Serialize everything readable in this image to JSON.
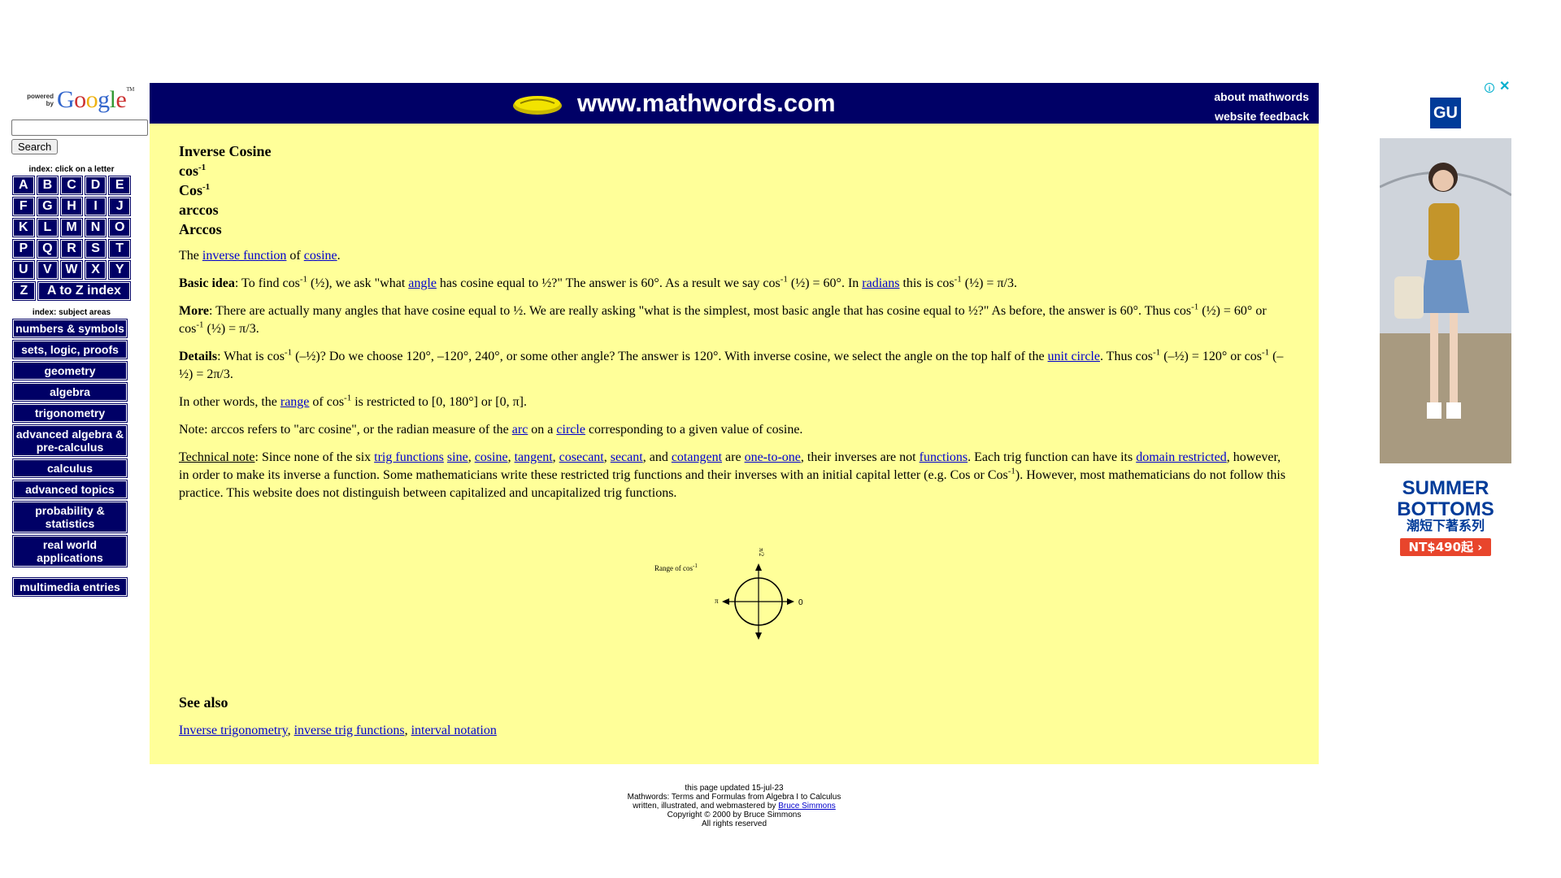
{
  "sidebar": {
    "powered_by": "powered by",
    "google_logo": "Google",
    "google_tm": "TM",
    "search_button": "Search",
    "letter_index_caption": "index: click on a letter",
    "letters": [
      [
        "A",
        "B",
        "C",
        "D",
        "E"
      ],
      [
        "F",
        "G",
        "H",
        "I",
        "J"
      ],
      [
        "K",
        "L",
        "M",
        "N",
        "O"
      ],
      [
        "P",
        "Q",
        "R",
        "S",
        "T"
      ],
      [
        "U",
        "V",
        "W",
        "X",
        "Y"
      ]
    ],
    "letter_z": "Z",
    "a_to_z": "A to Z index",
    "subject_caption": "index: subject areas",
    "subjects": [
      "numbers & symbols",
      "sets, logic, proofs",
      "geometry",
      "algebra",
      "trigonometry",
      "advanced algebra & pre-calculus",
      "calculus",
      "advanced topics",
      "probability & statistics",
      "real world applications"
    ],
    "multimedia": "multimedia entries"
  },
  "header": {
    "site_title": "www.mathwords.com",
    "about": "about mathwords",
    "feedback": "website feedback",
    "colors": {
      "banner": "#000066",
      "content": "#ffff99",
      "link": "#0000cc"
    }
  },
  "entry": {
    "titles": [
      "Inverse Cosine",
      "cos",
      "Cos",
      "arccos",
      "Arccos"
    ],
    "sup": "-1",
    "intro": {
      "the": "The",
      "inverse_function": "inverse function",
      "of": "of",
      "cosine": "cosine",
      "end": "."
    },
    "basic": {
      "label": "Basic idea",
      "t1": ": To find cos",
      "t2": " (½), we ask \"what ",
      "angle": "angle",
      "t3": " has cosine equal to ½?\" The answer is 60°. As a result we say cos",
      "t4": " (½) = 60°. In ",
      "radians": "radians",
      "t5": " this is cos",
      "t6": " (½) = π/3."
    },
    "more": {
      "label": "More",
      "t1": ": There are actually many angles that have cosine equal to ½. We are really asking \"what is the simplest, most basic angle that has cosine equal to ½?\" As before, the answer is 60°. Thus cos",
      "t2": " (½) = 60° or cos",
      "t3": " (½) = π/3."
    },
    "details": {
      "label": "Details",
      "t1": ": What is cos",
      "t2": " (–½)? Do we choose 120°, –120°, 240°, or some other angle? The answer is 120°. With inverse cosine, we select the angle on the top half of the ",
      "unit_circle": "unit circle",
      "t3": ". Thus cos",
      "t4": " (–½) = 120° or cos",
      "t5": " (–½) = 2π/3."
    },
    "other_words": {
      "t1": "In other words, the ",
      "range": "range",
      "t2": " of cos",
      "t3": " is restricted to [0, 180°] or [0, π]."
    },
    "note": {
      "t1": "Note: arccos refers to \"arc cosine\", or the radian measure of the ",
      "arc": "arc",
      "t2": " on a ",
      "circle": "circle",
      "t3": " corresponding to a given value of cosine."
    },
    "technical": {
      "label": "Technical note",
      "t1": ": Since none of the six ",
      "trig_functions": "trig functions",
      "sine": "sine",
      "cosine": "cosine",
      "tangent": "tangent",
      "cosecant": "cosecant",
      "secant": "secant",
      "cotangent": "cotangent",
      "one_to_one": "one-to-one",
      "functions": "functions",
      "domain_restricted": "domain restricted",
      "c": ", ",
      "sp": " ",
      "and": ", and ",
      "are": " are ",
      "t2": ", their inverses are not ",
      "t3": ". Each trig function can have its ",
      "t4": ", however, in order to make its inverse a function. Some mathematicians write these restricted trig functions and their inverses with an initial capital letter (e.g. Cos or Cos",
      "t5": "). However, most mathematicians do not follow this practice. This website does not distinguish between capitalized and uncapitalized trig functions."
    },
    "diagram": {
      "range_label": "Range of cos",
      "sup": "-1",
      "top_label": "π/2",
      "left_label": "π",
      "right_label": "0"
    },
    "see_also": {
      "heading": "See also",
      "links": [
        "Inverse trigonometry",
        "inverse trig functions",
        "interval notation"
      ],
      "sep": ", "
    }
  },
  "footer": {
    "updated": "this page updated 15-jul-23",
    "tagline": "Mathwords: Terms and Formulas from Algebra I to Calculus",
    "written": "written, illustrated, and webmastered by ",
    "author": "Bruce Simmons",
    "copyright": "Copyright © 2000 by Bruce Simmons",
    "rights": "All rights reserved"
  },
  "ad": {
    "info_icon": "i",
    "close_icon": "✕",
    "brand": "GU",
    "headline": "SUMMER BOTTOMS",
    "sub": "潮短下著系列",
    "price": "NT$490起 ›",
    "brand_color": "#003b99",
    "price_color": "#e8452c"
  }
}
